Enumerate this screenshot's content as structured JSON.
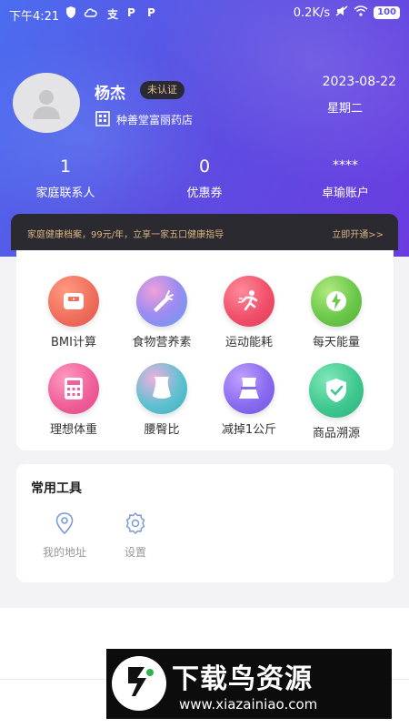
{
  "status_bar": {
    "time": "下午4:21",
    "speed": "0.2K/s",
    "battery": "100"
  },
  "profile": {
    "name": "杨杰",
    "badge": "未认证",
    "store": "种善堂富丽药店",
    "date": "2023-08-22",
    "weekday": "星期二"
  },
  "stats": [
    {
      "value": "1",
      "label": "家庭联系人"
    },
    {
      "value": "0",
      "label": "优惠券"
    },
    {
      "value": "****",
      "label": "卓瑜账户"
    }
  ],
  "banner": {
    "text": "家庭健康档案，99元/年，立享一家五口健康指导",
    "link": "立即开通>>"
  },
  "features": [
    {
      "label": "BMI计算",
      "icon": "scale-icon",
      "color": "#f0705e"
    },
    {
      "label": "食物营养素",
      "icon": "carrot-icon",
      "color": "#7e8bf0"
    },
    {
      "label": "运动能耗",
      "icon": "runner-icon",
      "color": "#f0506a"
    },
    {
      "label": "每天能量",
      "icon": "lightning-icon",
      "color": "#6cc84a"
    },
    {
      "label": "理想体重",
      "icon": "calculator-icon",
      "color": "#f0609a"
    },
    {
      "label": "腰臀比",
      "icon": "waist-icon",
      "color": "#48c0c8"
    },
    {
      "label": "减掉1公斤",
      "icon": "belly-icon",
      "color": "#8a6cf0"
    },
    {
      "label": "商品溯源",
      "icon": "shield-check-icon",
      "color": "#40c890"
    }
  ],
  "tools": {
    "title": "常用工具",
    "items": [
      {
        "label": "我的地址",
        "icon": "location-pin-icon"
      },
      {
        "label": "设置",
        "icon": "gear-icon"
      }
    ]
  },
  "watermark": {
    "title": "下载鸟资源",
    "url": "www.xiazainiao.com"
  }
}
